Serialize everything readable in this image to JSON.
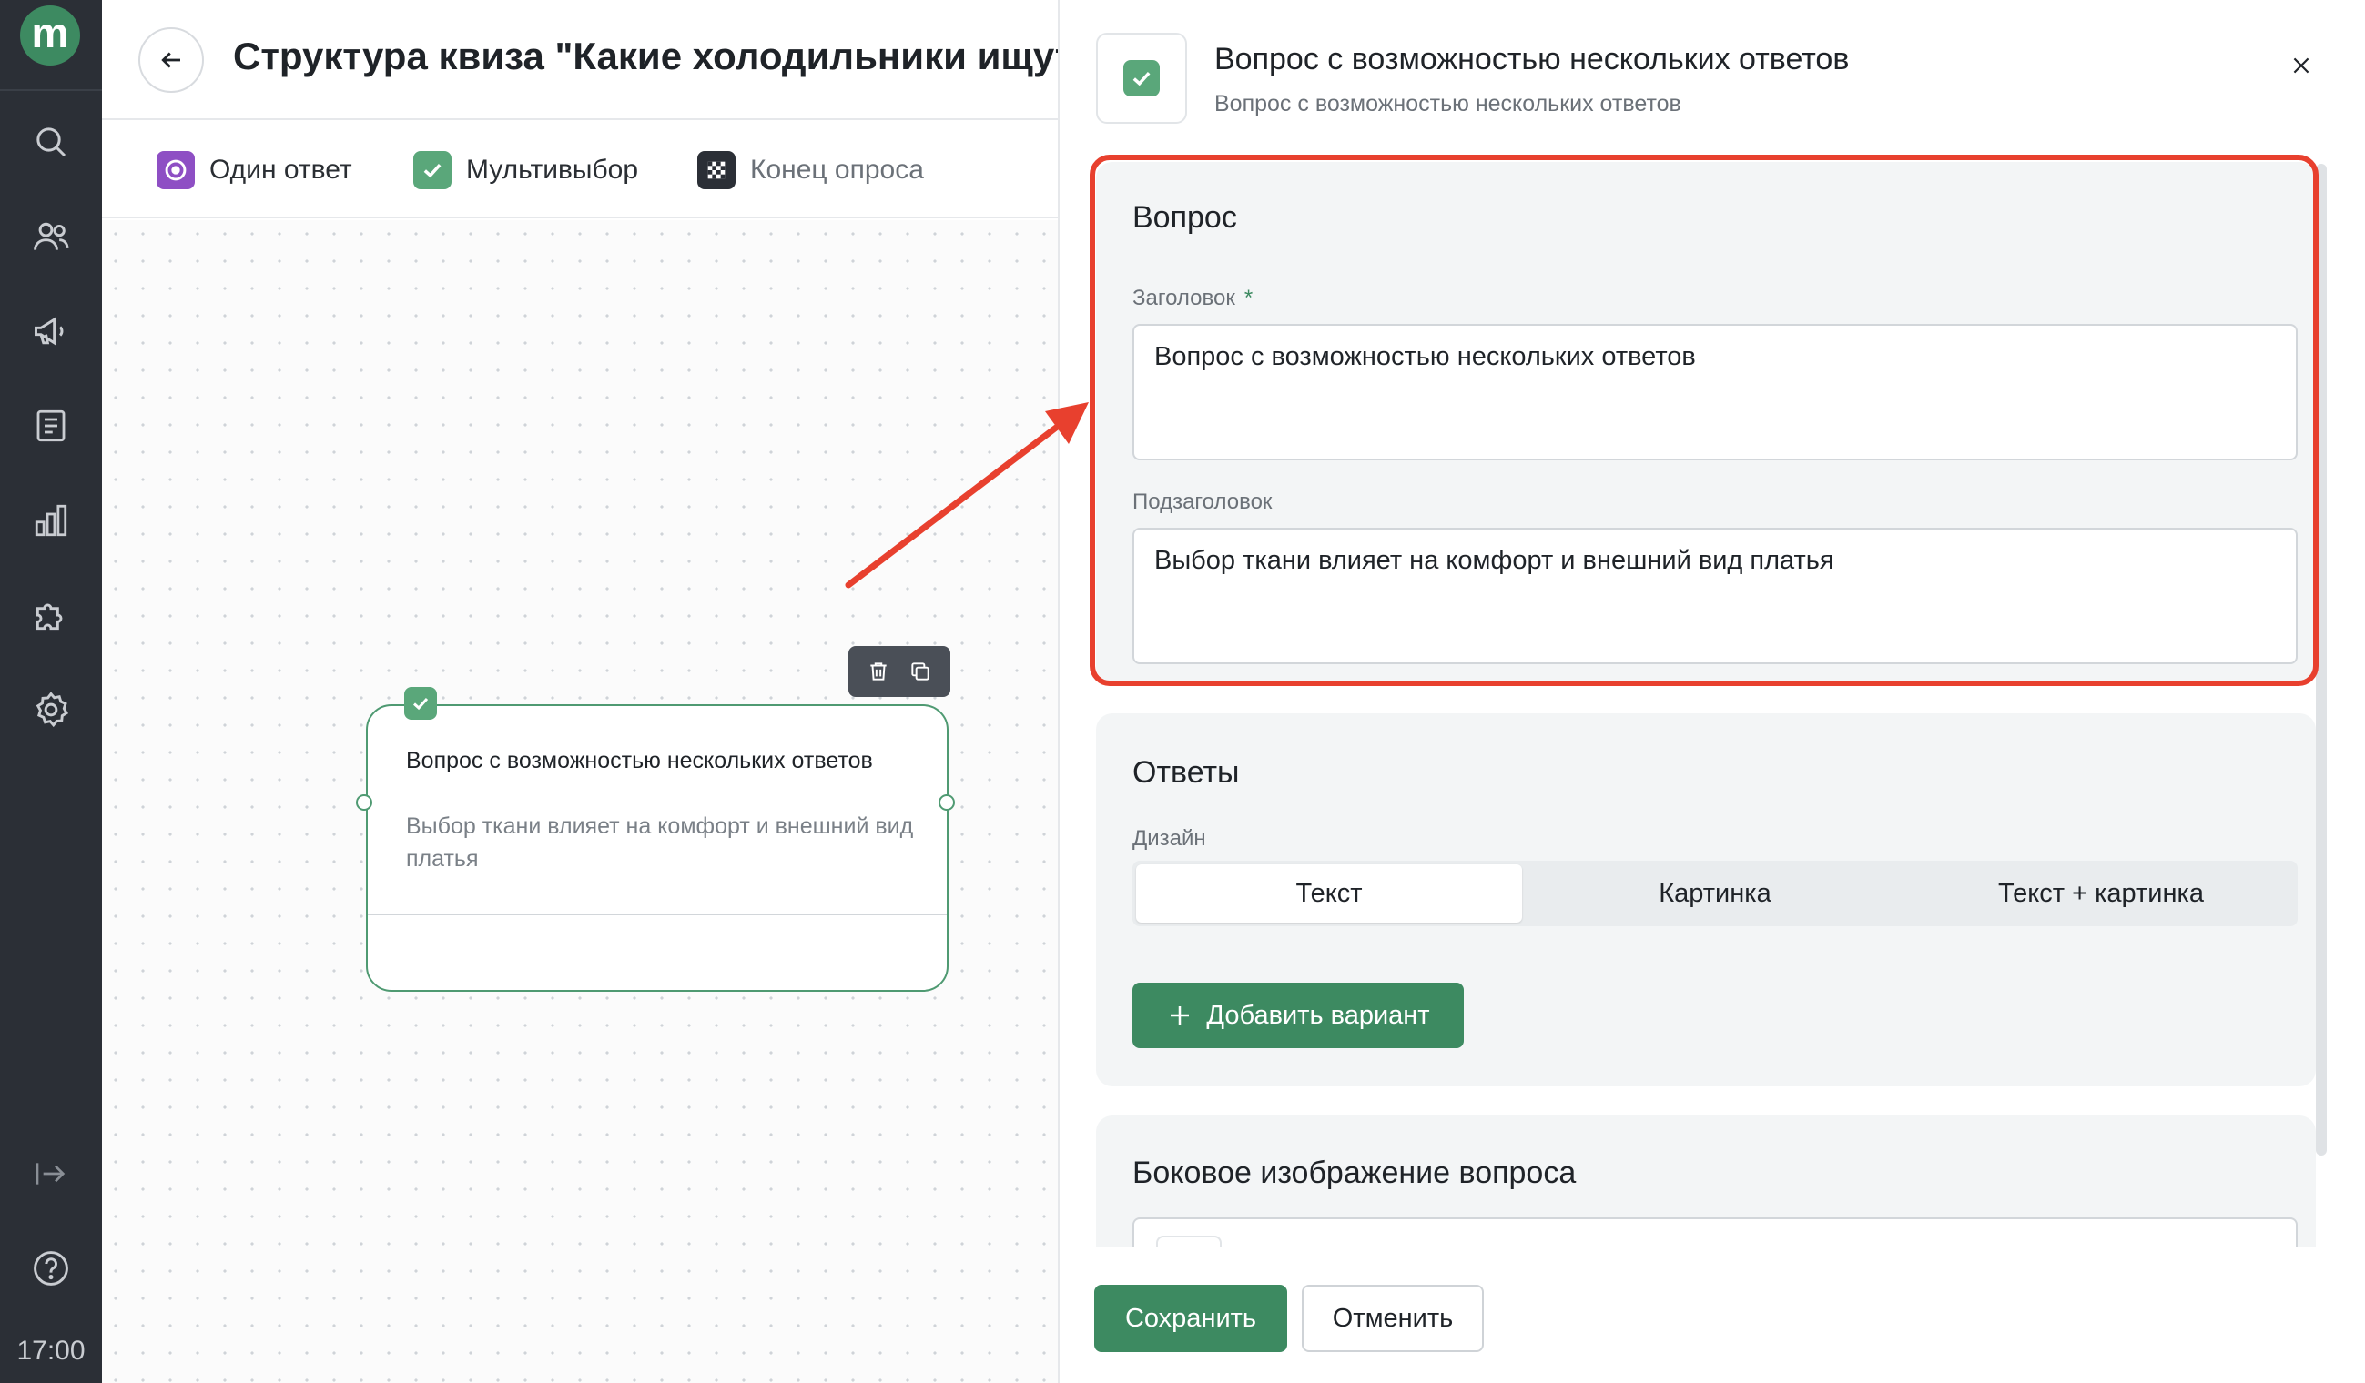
{
  "app": {
    "logo_letter": "m",
    "clock": "17:00",
    "brand_color": "#3d8a61"
  },
  "sidebar": {
    "icons": [
      "search-icon",
      "users-icon",
      "megaphone-icon",
      "document-icon",
      "chart-icon",
      "puzzle-icon",
      "gear-icon"
    ],
    "bottom_icons": [
      "logout-icon",
      "help-icon"
    ]
  },
  "header": {
    "title": "Структура квиза \"Какие холодильники ищут п"
  },
  "palette": {
    "items": [
      {
        "label": "Один ответ",
        "icon": "radio-icon"
      },
      {
        "label": "Мультивыбор",
        "icon": "checkbox-icon"
      },
      {
        "label": "Конец опроса",
        "icon": "flag-icon"
      }
    ]
  },
  "node": {
    "title": "Вопрос с возможностью нескольких ответов",
    "subtitle": "Выбор ткани влияет на комфорт и внешний вид платья"
  },
  "panel": {
    "title": "Вопрос с возможностью нескольких ответов",
    "subtitle": "Вопрос с возможностью нескольких ответов",
    "question_section": {
      "heading": "Вопрос",
      "title_label": "Заголовок",
      "required_mark": "*",
      "title_value": "Вопрос с возможностью нескольких ответов",
      "subtitle_label": "Подзаголовок",
      "subtitle_value": "Выбор ткани влияет на комфорт и внешний вид платья"
    },
    "answers_section": {
      "heading": "Ответы",
      "design_label": "Дизайн",
      "design_options": [
        "Текст",
        "Картинка",
        "Текст + картинка"
      ],
      "selected_design": "Текст",
      "add_button": "Добавить вариант"
    },
    "side_image_section": {
      "heading": "Боковое изображение вопроса"
    },
    "save_button": "Сохранить",
    "cancel_button": "Отменить"
  },
  "annotation": {
    "color": "#e8402e"
  }
}
